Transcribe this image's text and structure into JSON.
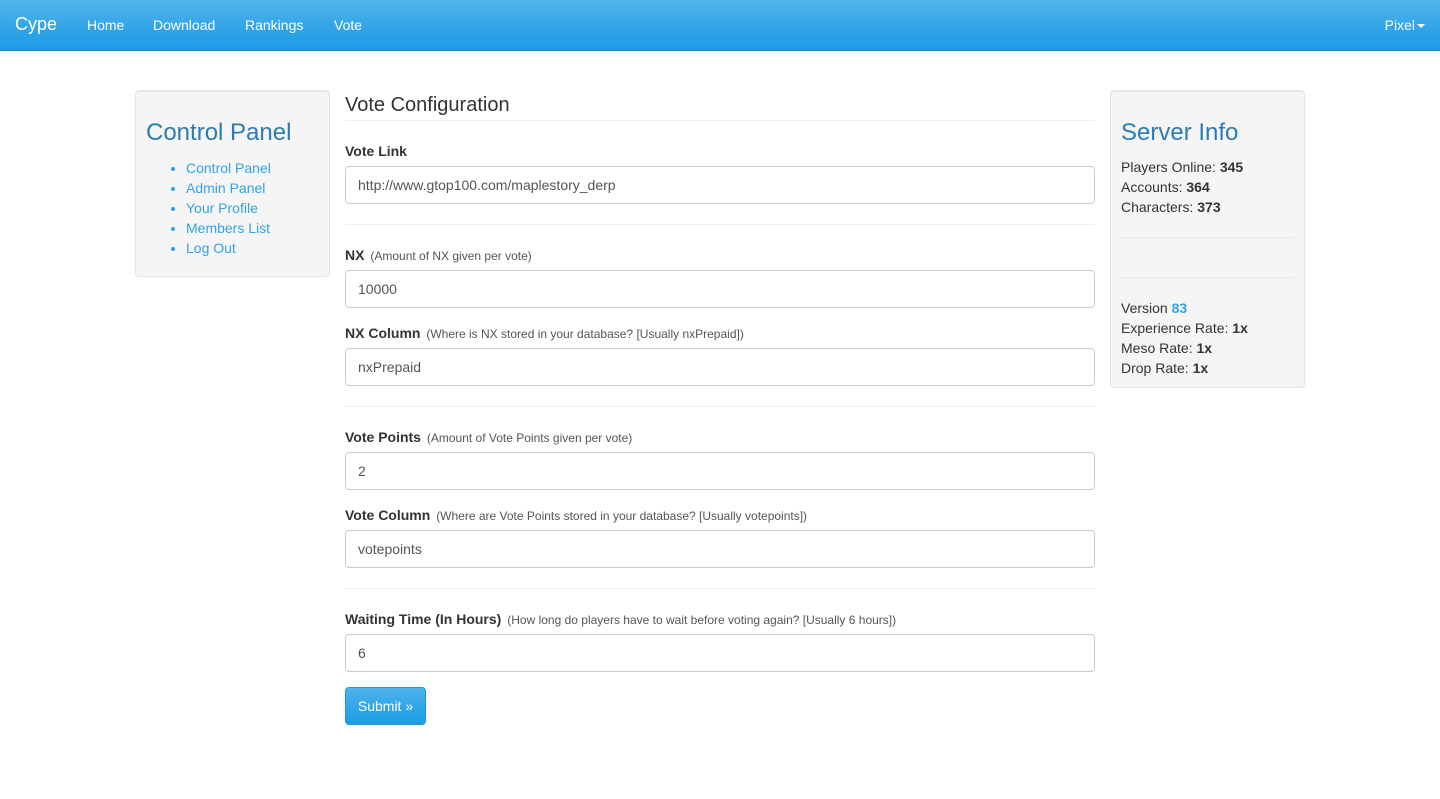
{
  "navbar": {
    "brand": "Cype",
    "links": [
      "Home",
      "Download",
      "Rankings",
      "Vote"
    ],
    "user": "Pixel"
  },
  "control_panel": {
    "title": "Control Panel",
    "items": [
      "Control Panel",
      "Admin Panel",
      "Your Profile",
      "Members List",
      "Log Out"
    ]
  },
  "form": {
    "title": "Vote Configuration",
    "vote_link": {
      "label": "Vote Link",
      "value": "http://www.gtop100.com/maplestory_derp"
    },
    "nx": {
      "label": "NX",
      "hint": "(Amount of NX given per vote)",
      "value": "10000"
    },
    "nx_column": {
      "label": "NX Column",
      "hint": "(Where is NX stored in your database? [Usually nxPrepaid])",
      "value": "nxPrepaid"
    },
    "vote_points": {
      "label": "Vote Points",
      "hint": "(Amount of Vote Points given per vote)",
      "value": "2"
    },
    "vote_column": {
      "label": "Vote Column",
      "hint": "(Where are Vote Points stored in your database? [Usually votepoints])",
      "value": "votepoints"
    },
    "waiting_time": {
      "label": "Waiting Time (In Hours)",
      "hint": "(How long do players have to wait before voting again? [Usually 6 hours])",
      "value": "6"
    },
    "submit_label": "Submit »"
  },
  "server_info": {
    "title": "Server Info",
    "players_online": {
      "label": "Players Online:",
      "value": "345"
    },
    "accounts": {
      "label": "Accounts:",
      "value": "364"
    },
    "characters": {
      "label": "Characters:",
      "value": "373"
    },
    "version": {
      "label": "Version",
      "value": "83"
    },
    "exp_rate": {
      "label": "Experience Rate:",
      "value": "1x"
    },
    "meso_rate": {
      "label": "Meso Rate:",
      "value": "1x"
    },
    "drop_rate": {
      "label": "Drop Rate:",
      "value": "1x"
    }
  }
}
